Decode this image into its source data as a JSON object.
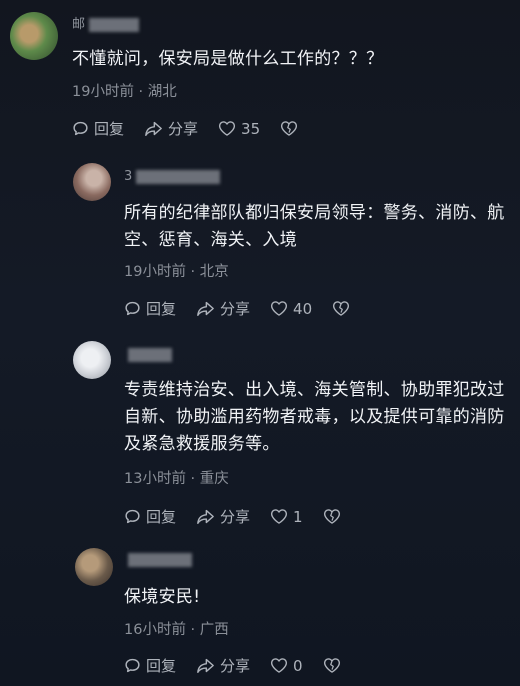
{
  "comments": [
    {
      "name": "邮",
      "text": "不懂就问，保安局是做什么工作的？？？",
      "meta": "19小时前 · 湖北",
      "reply": "回复",
      "share": "分享",
      "likes": "35",
      "avatar_colors": [
        "#5e8a4a",
        "#b89a6a"
      ]
    },
    {
      "name": "3",
      "text": "所有的纪律部队都归保安局领导：警务、消防、航空、惩育、海关、入境",
      "meta": "19小时前 · 北京",
      "reply": "回复",
      "share": "分享",
      "likes": "40",
      "avatar_colors": [
        "#8a6a60",
        "#c9b3a8"
      ]
    },
    {
      "name": "",
      "text": "专责维持治安、出入境、海关管制、协助罪犯改过自新、协助滥用药物者戒毒，以及提供可靠的消防及紧急救援服务等。",
      "meta": "13小时前 · 重庆",
      "reply": "回复",
      "share": "分享",
      "likes": "1",
      "avatar_colors": [
        "#cfd2d8",
        "#9aa0a8"
      ]
    },
    {
      "name": "",
      "text": "保境安民!",
      "meta": "16小时前 · 广西",
      "reply": "回复",
      "share": "分享",
      "likes": "0",
      "avatar_colors": [
        "#6a5a4a",
        "#b59a7a"
      ]
    }
  ]
}
